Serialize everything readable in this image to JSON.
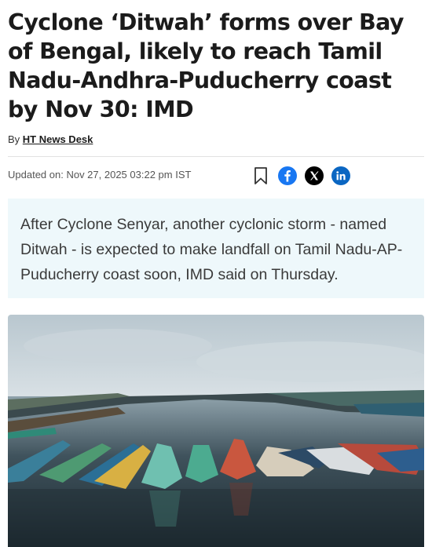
{
  "article": {
    "headline": "Cyclone ‘Ditwah’ forms over Bay of Bengal, likely to reach Tamil Nadu-Andhra-Puducherry coast by Nov 30: IMD",
    "byline_prefix": "By",
    "author": "HT News Desk",
    "updated": "Updated on: Nov 27, 2025 03:22 pm IST",
    "summary": "After Cyclone Senyar, another cyclonic storm - named Ditwah - is expected to make landfall on Tamil Nadu-AP-Puducherry coast soon, IMD said on Thursday."
  },
  "share": {
    "icons": [
      "bookmark-icon",
      "facebook-icon",
      "x-icon",
      "linkedin-icon"
    ],
    "colors": {
      "facebook": "#1877f2",
      "x": "#000000",
      "linkedin": "#0a66c2"
    }
  },
  "colors": {
    "summary_bg": "#eef8fb",
    "headline": "#1b1b1b"
  }
}
